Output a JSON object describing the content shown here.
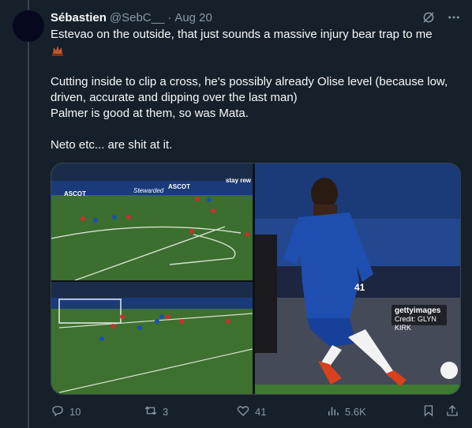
{
  "tweet": {
    "author_name": "Sébastien",
    "handle": "@SebC__",
    "separator": "·",
    "time": "Aug 20",
    "text_line1": "Estevao on the outside, that just sounds a massive injury bear trap to me",
    "text_para2": "Cutting inside to clip a cross, he's possibly already Olise level (because low, driven, accurate and dipping over the last man)\nPalmer is good at them, so was Mata.",
    "text_para3": "Neto etc... are shit at it.",
    "emoji_icon": "bear-trap-emoji-icon"
  },
  "media": {
    "getty_logo": "gettyimages",
    "getty_credit": "Credit: GLYN KIRK",
    "pitch_ads": [
      "ASCOT",
      "Stewarded",
      "ASCOT",
      "stay rew"
    ],
    "photo_player_number": "41",
    "pitch_color": "#3a6b30",
    "kit_color": "#1e4fb0"
  },
  "actions": {
    "replies": "10",
    "reposts": "3",
    "likes": "41",
    "views": "5.6K"
  },
  "icons": [
    "grok-icon",
    "more-icon",
    "reply-icon",
    "repost-icon",
    "like-icon",
    "views-icon",
    "bookmark-icon",
    "share-icon"
  ]
}
